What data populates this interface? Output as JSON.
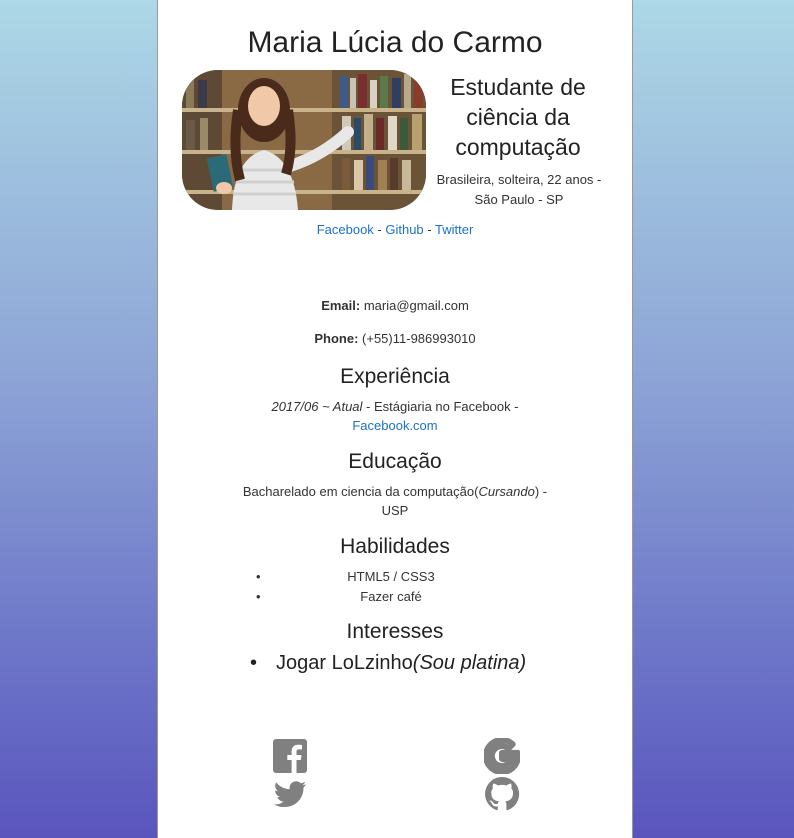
{
  "profile": {
    "name": "Maria Lúcia do Carmo",
    "headline": "Estudante de ciência da computação",
    "personal": "Brasileira, solteira, 22 anos - São Paulo - SP"
  },
  "links": {
    "facebook": "Facebook",
    "github": "Github",
    "twitter": "Twitter",
    "separator": " - "
  },
  "contact": {
    "email_label": "Email:",
    "email": "maria@gmail.com",
    "phone_label": "Phone:",
    "phone": "(+55)11-986993010"
  },
  "experience": {
    "title": "Experiência",
    "period": "2017/06 ~ Atual",
    "description": " - Estágiaria no Facebook - ",
    "link": "Facebook.com"
  },
  "education": {
    "title": "Educação",
    "course": "Bacharelado em ciencia da computação",
    "status": "Cursando",
    "school": " - USP"
  },
  "skills": {
    "title": "Habilidades",
    "items": [
      "HTML5 / CSS3",
      "Fazer café"
    ]
  },
  "interests": {
    "title": "Interesses",
    "item_main": "Jogar LoLzinho",
    "item_note": "(Sou platina)"
  },
  "icons": [
    "facebook-icon",
    "google-icon",
    "twitter-icon",
    "github-icon"
  ],
  "colors": {
    "link": "#1a73c8",
    "icon": "#808080"
  }
}
